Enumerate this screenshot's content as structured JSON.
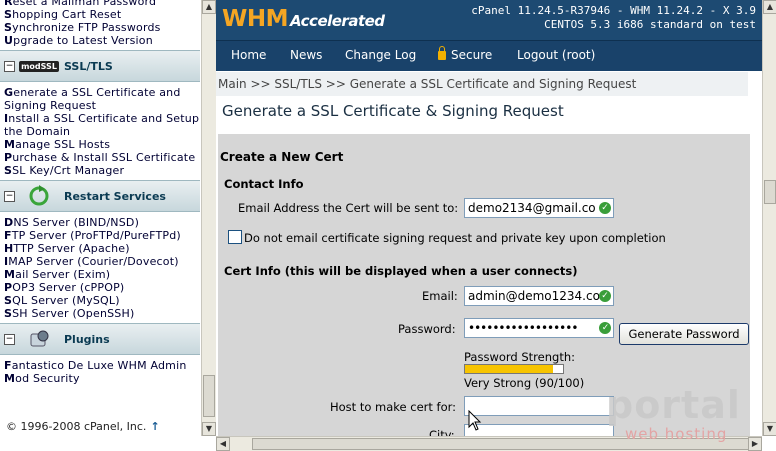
{
  "left_nav": {
    "top_links": [
      {
        "label": "Reset a Mailman Password"
      },
      {
        "label": "Shopping Cart Reset"
      },
      {
        "label": "Synchronize FTP Passwords"
      },
      {
        "label": "Upgrade to Latest Version"
      }
    ],
    "sections": [
      {
        "title": "SSL/TLS",
        "toggle": "−",
        "icon": "mod-ssl-icon",
        "icon_text": "modSSL",
        "links": [
          {
            "label": "Generate a SSL Certificate and Signing Request"
          },
          {
            "label": "Install a SSL Certificate and Setup the Domain"
          },
          {
            "label": "Manage SSL Hosts"
          },
          {
            "label": "Purchase & Install SSL Certificate"
          },
          {
            "label": "SSL Key/Crt Manager"
          }
        ]
      },
      {
        "title": "Restart Services",
        "toggle": "−",
        "icon": "restart-icon",
        "links": [
          {
            "label": "DNS Server (BIND/NSD)"
          },
          {
            "label": "FTP Server (ProFTPd/PureFTPd)"
          },
          {
            "label": "HTTP Server (Apache)"
          },
          {
            "label": "IMAP Server (Courier/Dovecot)"
          },
          {
            "label": "Mail Server (Exim)"
          },
          {
            "label": "POP3 Server (cPPOP)"
          },
          {
            "label": "SQL Server (MySQL)"
          },
          {
            "label": "SSH Server (OpenSSH)"
          }
        ]
      },
      {
        "title": "Plugins",
        "toggle": "−",
        "icon": "plugins-icon",
        "links": [
          {
            "label": "Fantastico De Luxe WHM Admin"
          },
          {
            "label": "Mod Security"
          }
        ]
      }
    ],
    "copyright": "© 1996-2008 cPanel, Inc.",
    "up_arrow": "↑"
  },
  "header": {
    "logo_brand": "WHM",
    "logo_suffix": "Accelerated",
    "version_line1": "cPanel 11.24.5-R37946 - WHM 11.24.2 - X 3.9",
    "version_line2": "CENTOS 5.3 i686 standard on test"
  },
  "menu": {
    "home": "Home",
    "news": "News",
    "changelog": "Change Log",
    "secure": "Secure",
    "logout": "Logout (root)"
  },
  "breadcrumb": "Main >> SSL/TLS >> Generate a SSL Certificate and Signing Request",
  "page_title": "Generate a SSL Certificate & Signing Request",
  "form": {
    "heading": "Create a New Cert",
    "contact_heading": "Contact Info",
    "email_to_label": "Email Address the Cert will be sent to:",
    "email_to_value": "demo2134@gmail.co",
    "no_email_label": "Do not email certificate signing request and private key upon completion",
    "cert_heading": "Cert Info (this will be displayed when a user connects)",
    "email_label": "Email:",
    "email_value": "admin@demo1234.co",
    "password_label": "Password:",
    "password_value": "••••••••••••••••••",
    "generate_button": "Generate Password",
    "strength_label": "Password Strength:",
    "strength_percent": 90,
    "strength_text": "Very Strong (90/100)",
    "host_label": "Host to make cert for:",
    "host_value": "",
    "city_label": "City:"
  },
  "watermark": {
    "word": "portal",
    "sub": "web hosting"
  },
  "colors": {
    "header_bg": "#1d4a72",
    "logo_orange": "#f5a623",
    "strength_yellow": "#f7c400",
    "form_bg": "#d6d6d6"
  }
}
